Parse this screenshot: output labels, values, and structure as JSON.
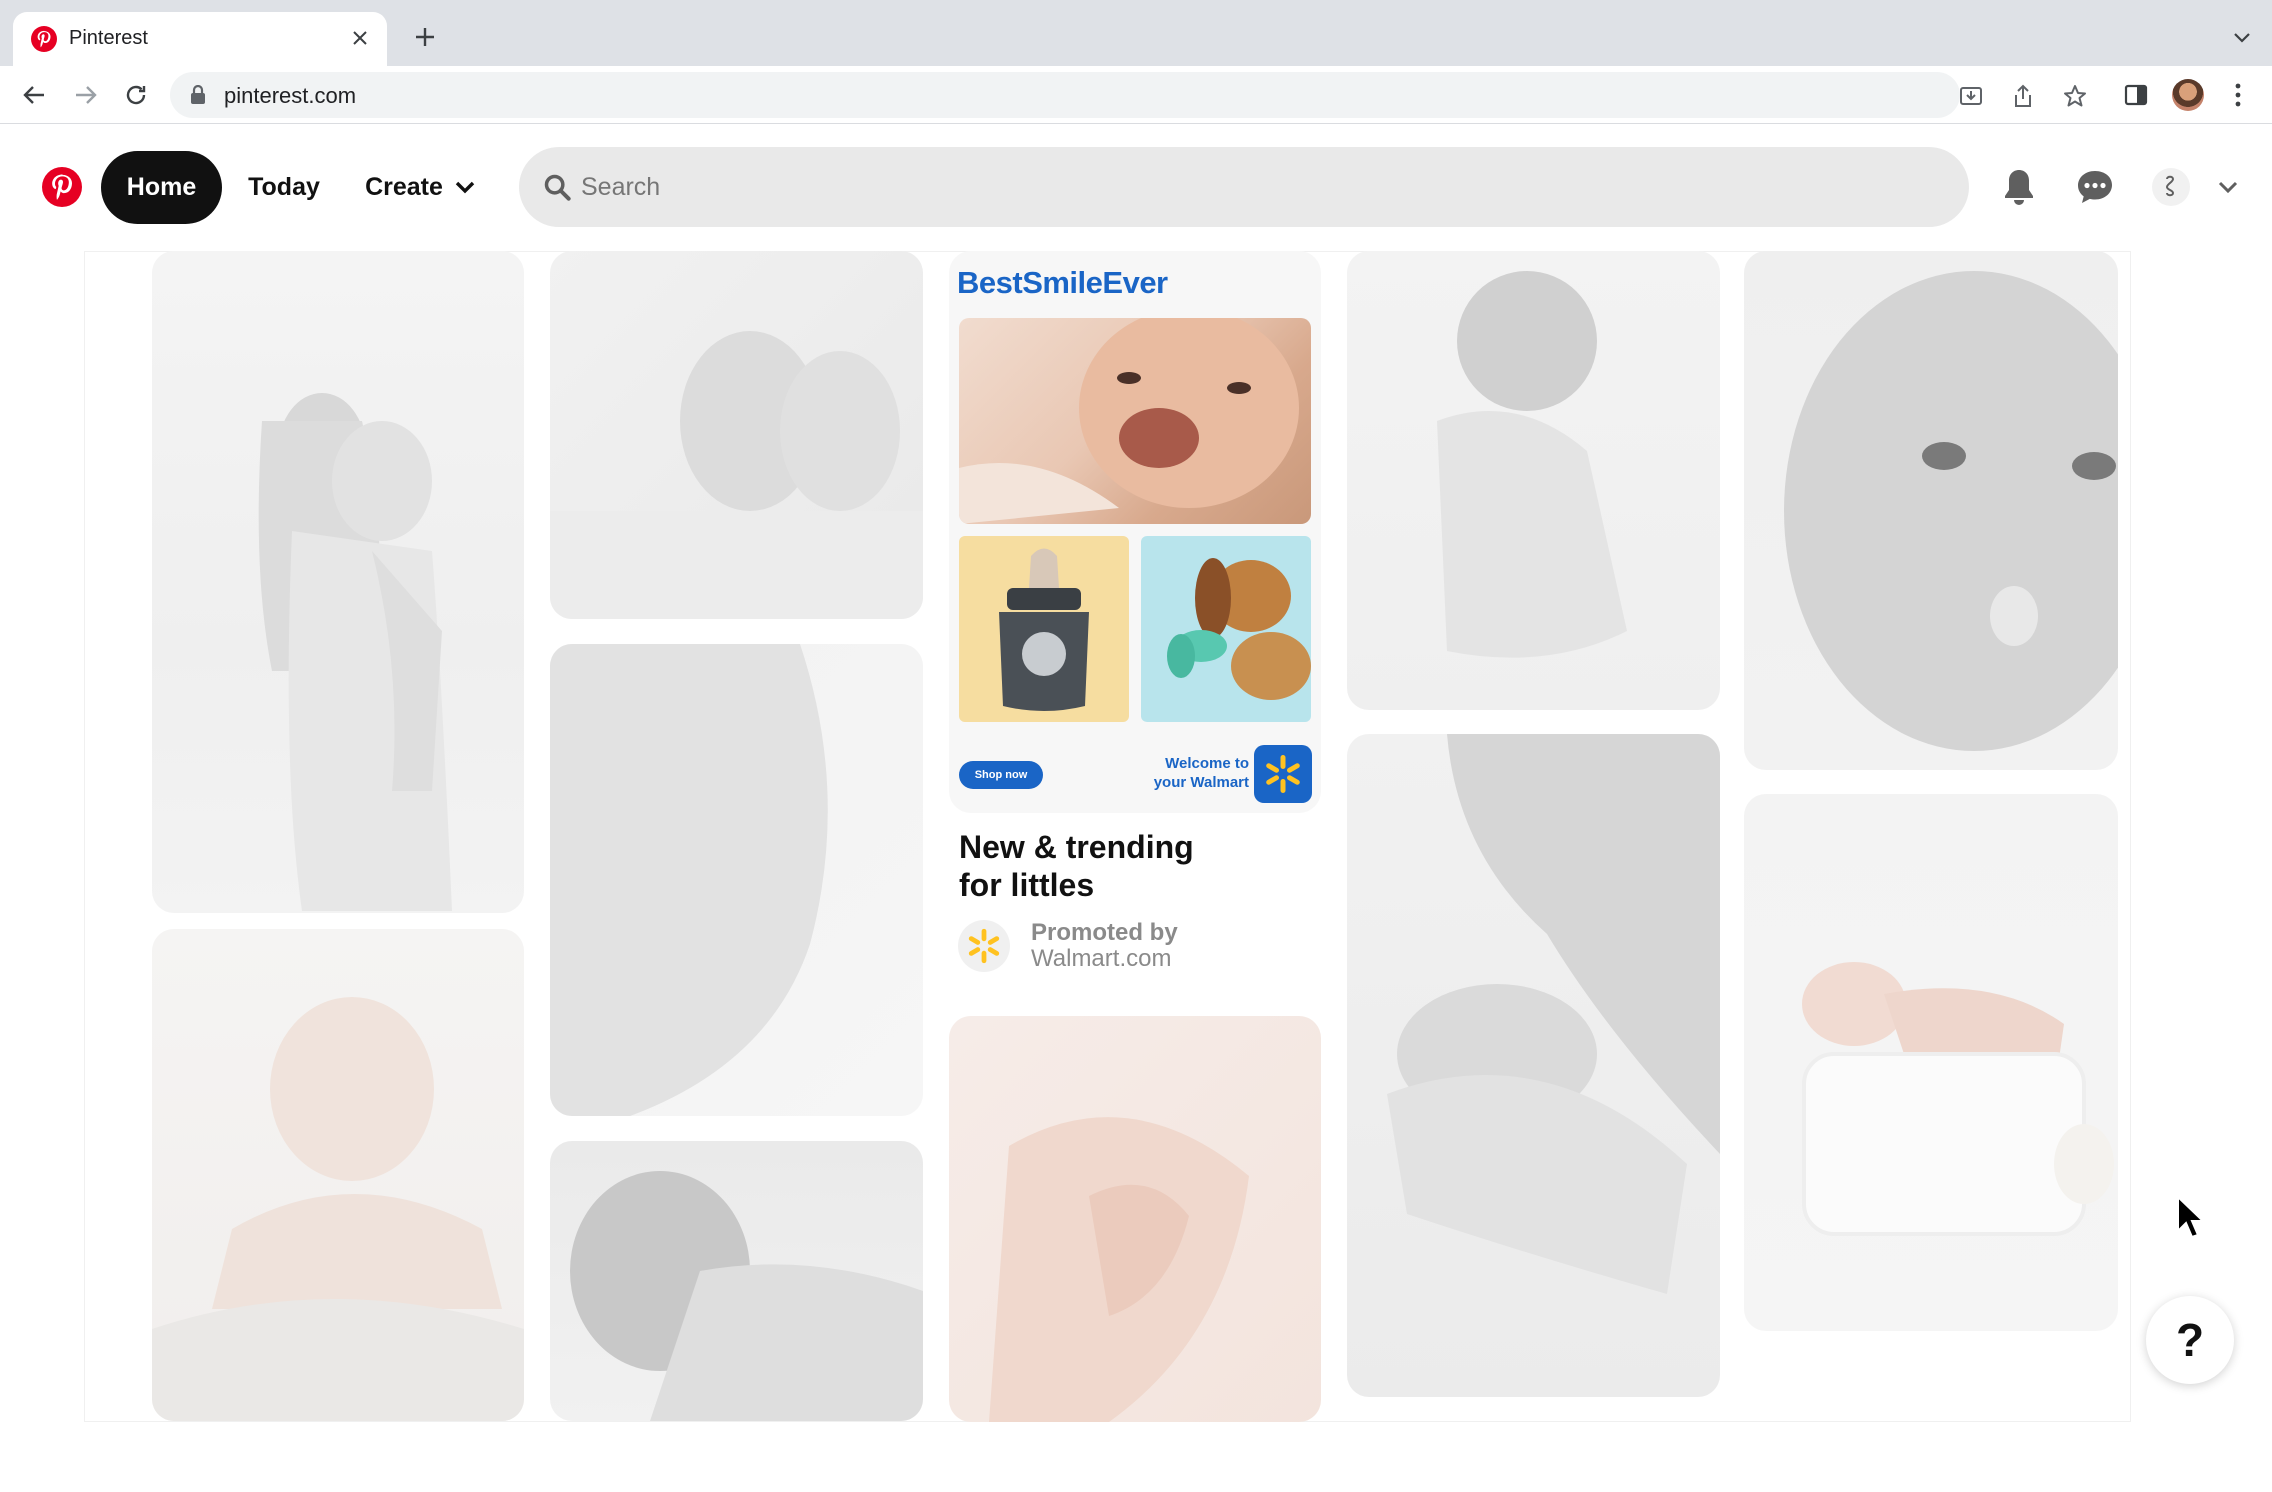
{
  "browser": {
    "tab_title": "Pinterest",
    "url": "pinterest.com"
  },
  "header": {
    "home_label": "Home",
    "today_label": "Today",
    "create_label": "Create",
    "search_placeholder": "Search"
  },
  "promoted_pin": {
    "brand": "BestSmileEver",
    "shop_now": "Shop now",
    "welcome_line1": "Welcome to",
    "welcome_line2": "your Walmart",
    "title_line1": "New & trending",
    "title_line2": "for littles",
    "promoted_by": "Promoted by",
    "advertiser": "Walmart.com"
  },
  "help": {
    "label": "?"
  },
  "colors": {
    "pinterest_red": "#e60023",
    "walmart_blue": "#1a65c6",
    "walmart_yellow": "#ffc220"
  }
}
